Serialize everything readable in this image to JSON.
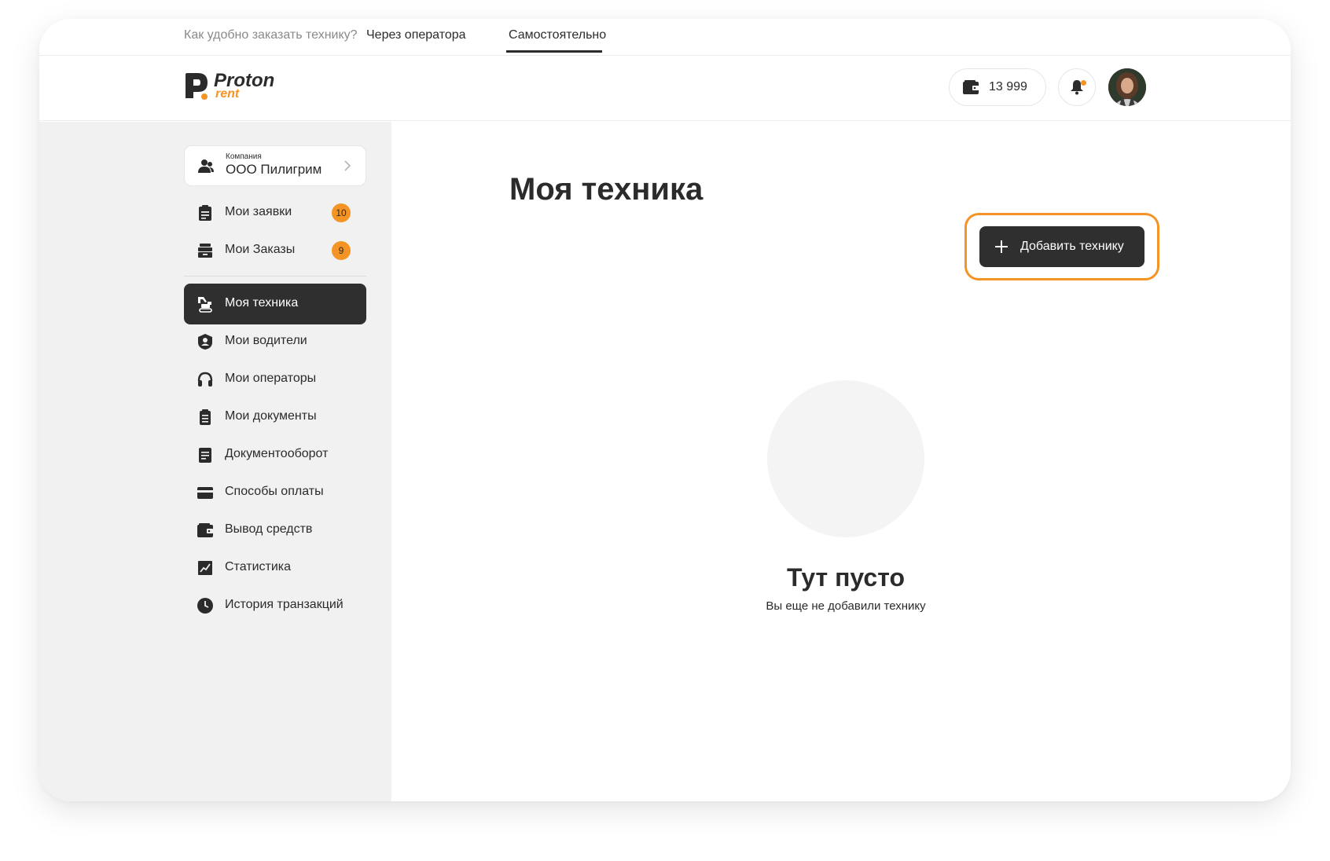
{
  "top_tabs": {
    "question": "Как удобно заказать технику?",
    "via_operator": "Через оператора",
    "self": "Самостоятельно"
  },
  "header": {
    "logo_word": "Proton",
    "logo_sub": "rent",
    "balance": "13 999"
  },
  "sidebar": {
    "company_caption": "Компания",
    "company_name": "ООО Пилигрим",
    "items": [
      {
        "label": "Мои заявки",
        "badge": "10",
        "icon": "clipboard-list-icon"
      },
      {
        "label": "Мои Заказы",
        "badge": "9",
        "icon": "inbox-stack-icon"
      },
      {
        "label": "Моя техника",
        "active": true,
        "icon": "excavator-icon"
      },
      {
        "label": "Мои водители",
        "icon": "driver-shield-icon"
      },
      {
        "label": "Мои операторы",
        "icon": "headphones-icon"
      },
      {
        "label": "Мои документы",
        "icon": "documents-icon"
      },
      {
        "label": "Документооборот",
        "icon": "document-flow-icon"
      },
      {
        "label": "Способы оплаты",
        "icon": "credit-card-icon"
      },
      {
        "label": "Вывод средств",
        "icon": "wallet-icon"
      },
      {
        "label": "Статистика",
        "icon": "chart-icon"
      },
      {
        "label": "История транзакций",
        "icon": "clock-icon"
      }
    ]
  },
  "main": {
    "title": "Моя техника",
    "add_button": "Добавить технику",
    "empty_title": "Тут пусто",
    "empty_subtitle": "Вы еще не добавили технику"
  },
  "colors": {
    "accent": "#f39425",
    "dark": "#2f2f2f",
    "sidebar_bg": "#f1f1f1"
  }
}
